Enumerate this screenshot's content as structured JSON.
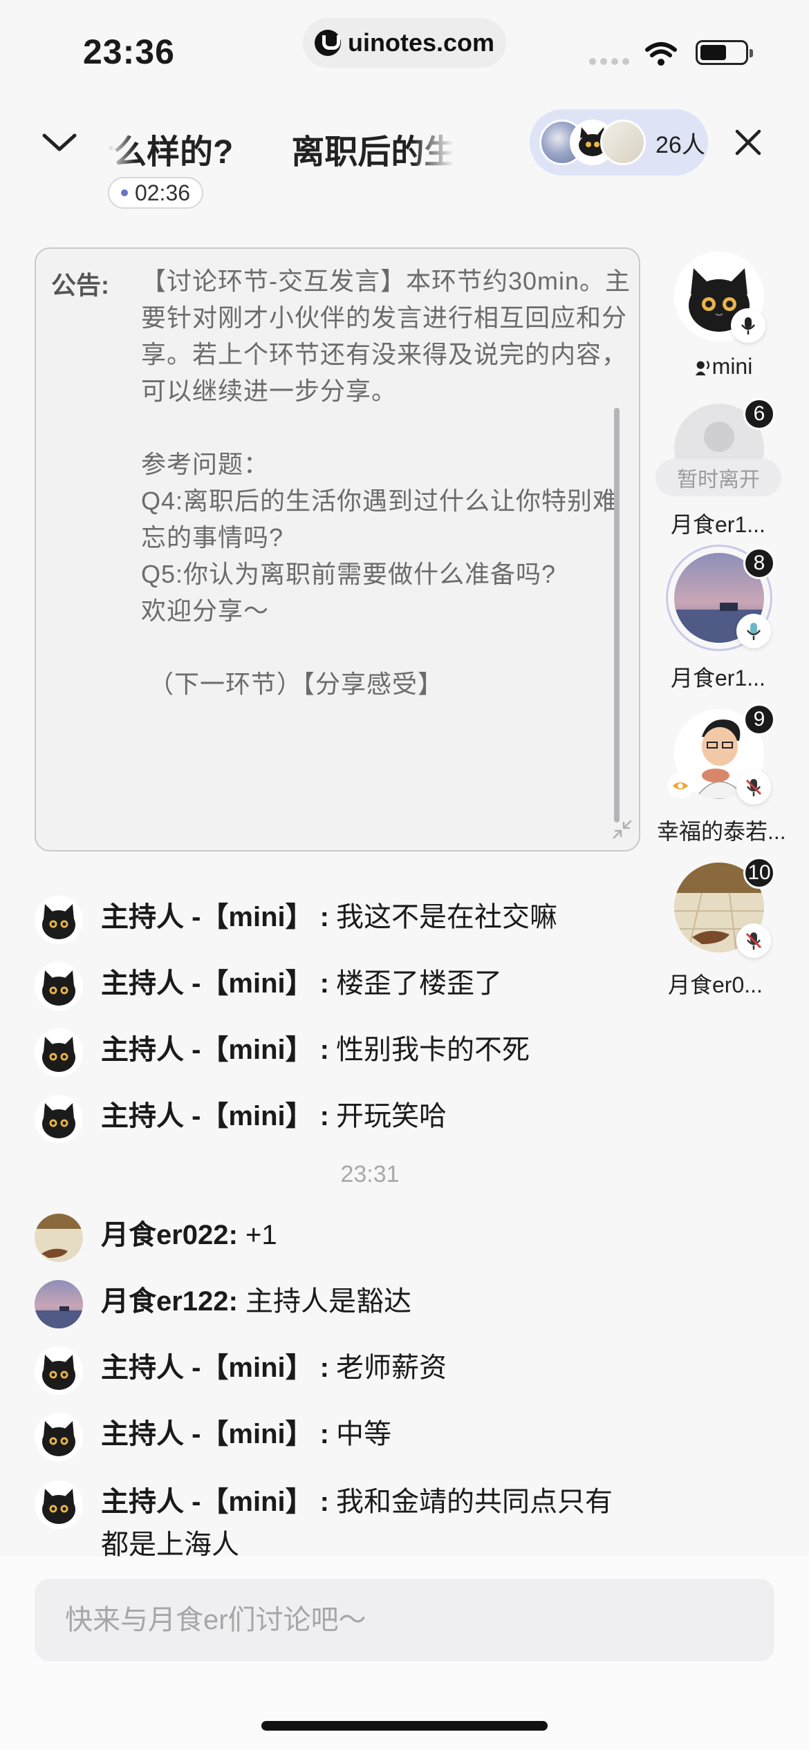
{
  "status_bar": {
    "time": "23:36",
    "url": "uinotes.com"
  },
  "header": {
    "title_segments": [
      "什么样的?",
      "离职后的生活"
    ],
    "member_count": "26人",
    "timer": "02:36"
  },
  "announcement": {
    "label": "公告:",
    "body": "【讨论环节-交互发言】本环节约30min。主要针对刚才小伙伴的发言进行相互回应和分享。若上个环节还有没来得及说完的内容，可以继续进一步分享。\n\n参考问题：\nQ4:离职后的生活你遇到过什么让你特别难忘的事情吗?\nQ5:你认为离职前需要做什么准备吗?\n欢迎分享～\n\n （下一环节）【分享感受】"
  },
  "participants": [
    {
      "name": "mini",
      "badge": "",
      "status": "host-speaking"
    },
    {
      "name": "月食er1...",
      "badge": "6",
      "status": "暂时离开"
    },
    {
      "name": "月食er1...",
      "badge": "8",
      "status": "mic-on"
    },
    {
      "name": "幸福的泰若...",
      "badge": "9",
      "status": "mic-off"
    },
    {
      "name": "月食er0...",
      "badge": "10",
      "status": "mic-off"
    }
  ],
  "chat": {
    "messages": [
      {
        "sender": "主持人 -【mini】",
        "sep": ":",
        "text": "我这不是在社交嘛",
        "avatar": "cat"
      },
      {
        "sender": "主持人 -【mini】",
        "sep": ":",
        "text": "楼歪了楼歪了",
        "avatar": "cat"
      },
      {
        "sender": "主持人 -【mini】",
        "sep": ":",
        "text": "性别我卡的不死",
        "avatar": "cat"
      },
      {
        "sender": "主持人 -【mini】",
        "sep": ":",
        "text": "开玩笑哈",
        "avatar": "cat"
      },
      {
        "sender": "月食er022",
        "sep": ":",
        "text": " +1",
        "avatar": "floor"
      },
      {
        "sender": "月食er122",
        "sep": ":",
        "text": " 主持人是豁达",
        "avatar": "sunset"
      },
      {
        "sender": "主持人 -【mini】",
        "sep": ":",
        "text": "老师薪资",
        "avatar": "cat"
      },
      {
        "sender": "主持人 -【mini】",
        "sep": ":",
        "text": "中等",
        "avatar": "cat"
      },
      {
        "sender": "主持人 -【mini】",
        "sep": ":",
        "text": "我和金靖的共同点只有都是上海人",
        "avatar": "cat"
      }
    ],
    "timestamp": "23:31"
  },
  "input": {
    "placeholder": "快来与月食er们讨论吧～"
  }
}
